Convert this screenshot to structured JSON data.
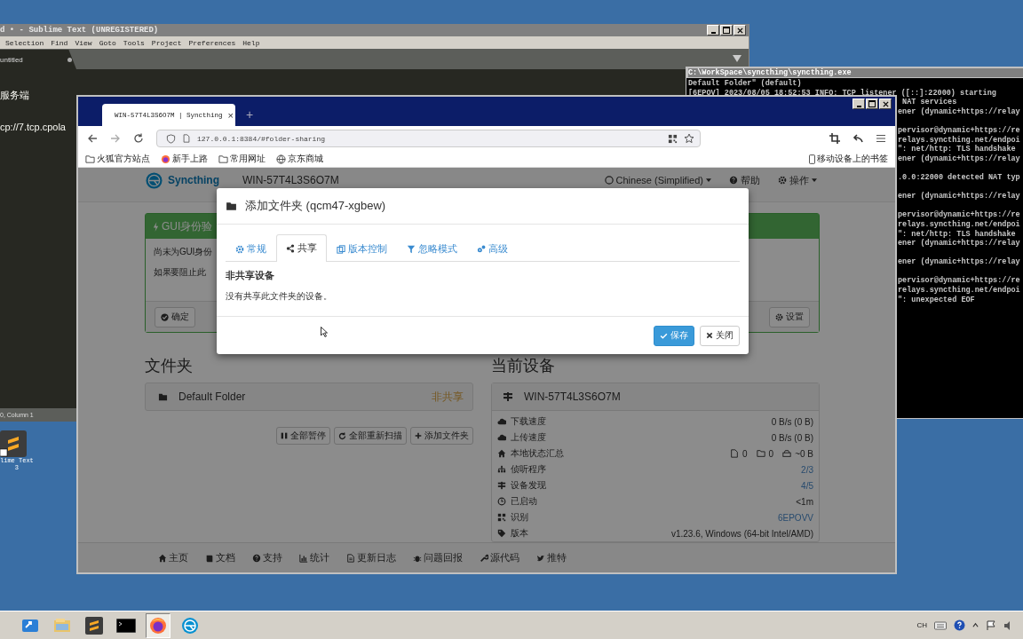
{
  "sublime": {
    "title": "d • - Sublime Text (UNREGISTERED)",
    "menu": [
      "Selection",
      "Find",
      "View",
      "Goto",
      "Tools",
      "Project",
      "Preferences",
      "Help"
    ],
    "tab": "untitled",
    "lines": [
      "服务端",
      "cp://7.tcp.cpola"
    ],
    "status": "0, Column 1"
  },
  "console": {
    "title": "C:\\WorkSpace\\syncthing\\syncthing.exe",
    "lines": [
      {
        "kind": "full",
        "text": "Default Folder\" (default)"
      },
      {
        "kind": "full",
        "text": "[6EPOV] 2023/08/05 18:52:53 INFO: TCP listener ([::]:22000) starting"
      },
      {
        "kind": "tail",
        "text": " NAT services"
      },
      {
        "kind": "tail",
        "text": "ener (dynamic+https://relay"
      },
      {
        "kind": "blank"
      },
      {
        "kind": "tail",
        "text": "pervisor@dynamic+https://re"
      },
      {
        "kind": "tail",
        "text": "relays.syncthing.net/endpoi"
      },
      {
        "kind": "tail",
        "text": "\": net/http: TLS handshake"
      },
      {
        "kind": "tail",
        "text": "ener (dynamic+https://relay"
      },
      {
        "kind": "blank"
      },
      {
        "kind": "tail",
        "text": ".0.0:22000 detected NAT typ"
      },
      {
        "kind": "blank"
      },
      {
        "kind": "tail",
        "text": "ener (dynamic+https://relay"
      },
      {
        "kind": "blank"
      },
      {
        "kind": "tail",
        "text": "pervisor@dynamic+https://re"
      },
      {
        "kind": "tail",
        "text": "relays.syncthing.net/endpoi"
      },
      {
        "kind": "tail",
        "text": "\": net/http: TLS handshake"
      },
      {
        "kind": "tail",
        "text": "ener (dynamic+https://relay"
      },
      {
        "kind": "blank"
      },
      {
        "kind": "tail",
        "text": "ener (dynamic+https://relay"
      },
      {
        "kind": "blank"
      },
      {
        "kind": "tail",
        "text": "pervisor@dynamic+https://re"
      },
      {
        "kind": "tail",
        "text": "relays.syncthing.net/endpoi"
      },
      {
        "kind": "tail",
        "text": "\": unexpected EOF"
      }
    ]
  },
  "browser": {
    "tab": {
      "title": "WIN-57T4L3S6O7M | Syncthing",
      "close": "×"
    },
    "new_tab": "+",
    "url": "127.0.0.1:8384/#folder-sharing",
    "bookmarks": [
      "火狐官方站点",
      "新手上路",
      "常用网址",
      "京东商城"
    ],
    "mobile_bookmarks": "移动设备上的书签"
  },
  "page": {
    "brand": "Syncthing",
    "device_name": "WIN-57T4L3S6O7M",
    "language": "Chinese (Simplified)",
    "help": "帮助",
    "actions": "操作",
    "alert": {
      "title": "GUI身份验",
      "lines": [
        "尚未为GUI身份",
        "如果要阻止此"
      ],
      "ok": "确定",
      "settings": "设置"
    },
    "folders": {
      "heading": "文件夹",
      "items": [
        {
          "name": "Default Folder",
          "status": "非共享"
        }
      ],
      "buttons": [
        "全部暂停",
        "全部重新扫描",
        "添加文件夹"
      ]
    },
    "device": {
      "heading": "当前设备",
      "name": "WIN-57T4L3S6O7M",
      "rows": [
        {
          "label": "下载速度",
          "value": "0 B/s (0 B)",
          "link": false
        },
        {
          "label": "上传速度",
          "value": "0 B/s (0 B)",
          "link": false
        },
        {
          "label": "本地状态汇总",
          "counts": [
            "0",
            "0",
            "~0 B"
          ]
        },
        {
          "label": "侦听程序",
          "value": "2/3",
          "link": true
        },
        {
          "label": "设备发现",
          "value": "4/5",
          "link": true
        },
        {
          "label": "已启动",
          "value": "<1m",
          "link": false
        },
        {
          "label": "识别",
          "value": "6EPOVV",
          "link": true
        },
        {
          "label": "版本",
          "value": "v1.23.6, Windows (64-bit Intel/AMD)",
          "link": false
        }
      ]
    },
    "footer": [
      "主页",
      "文档",
      "支持",
      "统计",
      "更新日志",
      "问题回报",
      "源代码",
      "推特"
    ]
  },
  "modal": {
    "title": "添加文件夹 (qcm47-xgbew)",
    "tabs": [
      {
        "label": "常规",
        "selected": false
      },
      {
        "label": "共享",
        "selected": true
      },
      {
        "label": "版本控制",
        "selected": false
      },
      {
        "label": "忽略模式",
        "selected": false
      },
      {
        "label": "高级",
        "selected": false
      }
    ],
    "section": "非共享设备",
    "empty": "没有共享此文件夹的设备。",
    "save": "保存",
    "close": "关闭"
  },
  "desktop_icon": {
    "label_lines": [
      "lime Text",
      "3"
    ]
  },
  "taskbar": {
    "apps": [
      {
        "selected": false
      },
      {
        "selected": false
      },
      {
        "selected": false
      },
      {
        "selected": false
      },
      {
        "selected": true
      },
      {
        "selected": false
      }
    ],
    "tray_text": "CH"
  }
}
